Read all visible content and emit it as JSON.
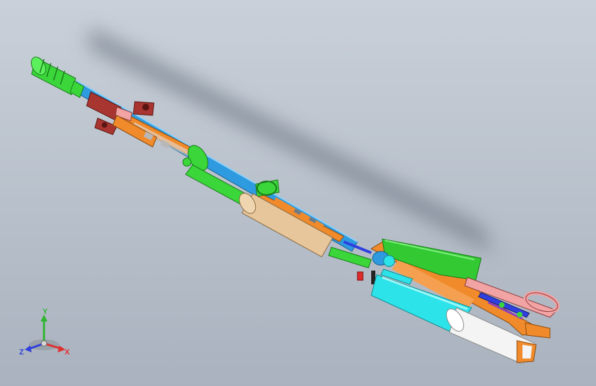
{
  "viewport": {
    "background_top": "#c9d0d9",
    "background_bottom": "#a9b2be"
  },
  "model": {
    "parts": {
      "muzzle_brake": "#3ad63a",
      "barrel": "#2e9be0",
      "front_sight_block": "#a8352f",
      "gas_system": "#f08a2a",
      "handguard_rings": "#3ad63a",
      "handguard": "#e7c69b",
      "receiver": "#f08a2a",
      "magazine": "#2be3e8",
      "magazine_base": "#f4f4f4",
      "rear_sight": "#33c933",
      "trigger_guard": "#f2a3a3",
      "internals": "#3040e0",
      "detail_red": "#e02a2a"
    }
  },
  "triad": {
    "x_label": "X",
    "y_label": "Y",
    "z_label": "Z",
    "x_color": "#e03030",
    "y_color": "#2fb52f",
    "z_color": "#2f3fdc"
  }
}
